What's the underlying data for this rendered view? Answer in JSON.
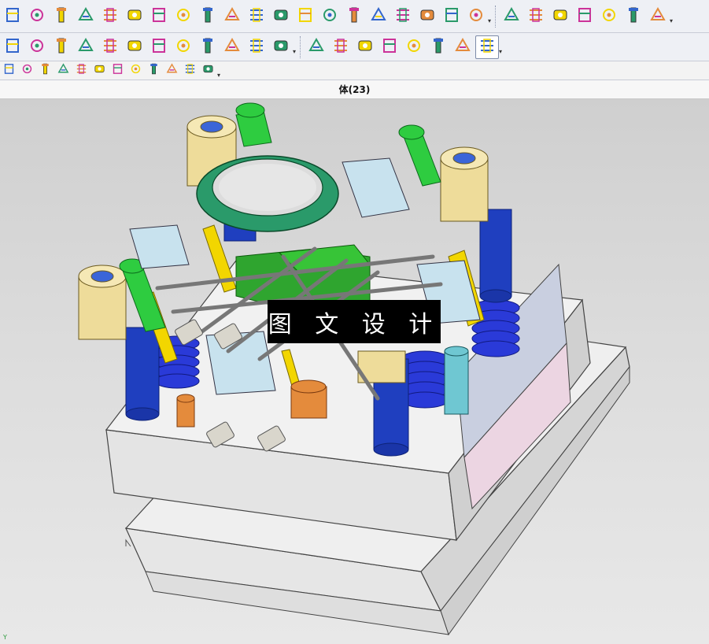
{
  "window": {
    "title": "体(23)"
  },
  "watermark": {
    "text": "图 文 设 计"
  },
  "viewport": {
    "axis_label": "Y"
  },
  "toolbar": {
    "row1_icons": [
      "mold-base-icon",
      "plate-icon",
      "ejector-pin-icon",
      "standard-part-icon",
      "slider-icon",
      "lifter-icon",
      "insert-icon",
      "spring-icon",
      "screw-icon",
      "cooling-icon",
      "locating-ring-icon",
      "sprue-bushing-icon",
      "electrode-icon",
      "pocket-icon",
      "gate-icon",
      "runner-icon",
      "bom-icon",
      "drawing-icon",
      "hole-table-icon",
      "settings-icon",
      "document-icon"
    ],
    "row1_right_icons": [
      "point-dimension-icon",
      "horizontal-dimension-icon",
      "vertical-dimension-icon",
      "xy-coordinate-icon",
      "ordinate-icon",
      "target-icon",
      "arrow-icon"
    ],
    "row2_icons": [
      "column-icon",
      "list-icon",
      "pin-icon",
      "bolt-icon",
      "stack-icon",
      "frame-icon",
      "flag-icon",
      "part-icon",
      "locator-icon",
      "guide-pillar-icon",
      "shoulder-icon",
      "rod-icon",
      "house-icon",
      "cup-icon"
    ],
    "row2_right_icons": [
      "assembly-icon",
      "color-icon",
      "pattern-icon",
      "csys-icon",
      "box-icon",
      "rotate-icon",
      "bracket-icon",
      "tools-icon"
    ],
    "row3_icons": [
      "point-set-icon",
      "snap-icon",
      "line-icon",
      "slash-line-icon",
      "curve-icon",
      "arc-icon",
      "circle-point-icon",
      "circle-icon",
      "plus-icon",
      "diagonal-icon",
      "paint-icon",
      "grid-icon"
    ]
  },
  "colors": {
    "toolbar_bg": "#eef0f5",
    "icon_blue": "#3366cc",
    "icon_magenta": "#cc3399",
    "icon_yellow": "#f2d600",
    "green_part": "#2ecc40",
    "blue_part": "#1f3fbf",
    "cream_part": "#eedc9a",
    "mold_gray": "#e4e4e4"
  }
}
